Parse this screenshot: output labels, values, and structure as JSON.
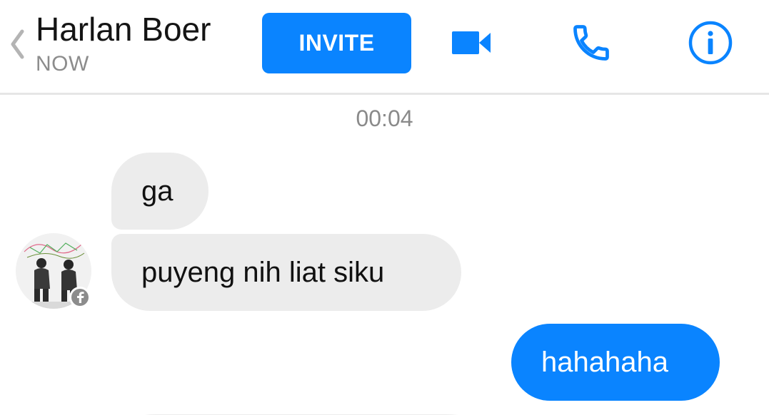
{
  "header": {
    "contact_name": "Harlan Boer",
    "status": "NOW",
    "invite_label": "INVITE",
    "icons": {
      "back": "chevron-left-icon",
      "video": "video-camera-icon",
      "phone": "phone-icon",
      "info": "info-icon"
    }
  },
  "conversation": {
    "timestamp": "00:04",
    "messages": [
      {
        "direction": "incoming",
        "text": "ga"
      },
      {
        "direction": "incoming",
        "text": "puyeng nih liat siku"
      },
      {
        "direction": "outgoing",
        "text": "hahahaha"
      }
    ]
  },
  "colors": {
    "accent": "#0a84ff",
    "incoming_bubble": "#ececec",
    "outgoing_bubble": "#0a84ff",
    "muted_text": "#8c8c8c",
    "back_chevron": "#b4b4b4"
  }
}
